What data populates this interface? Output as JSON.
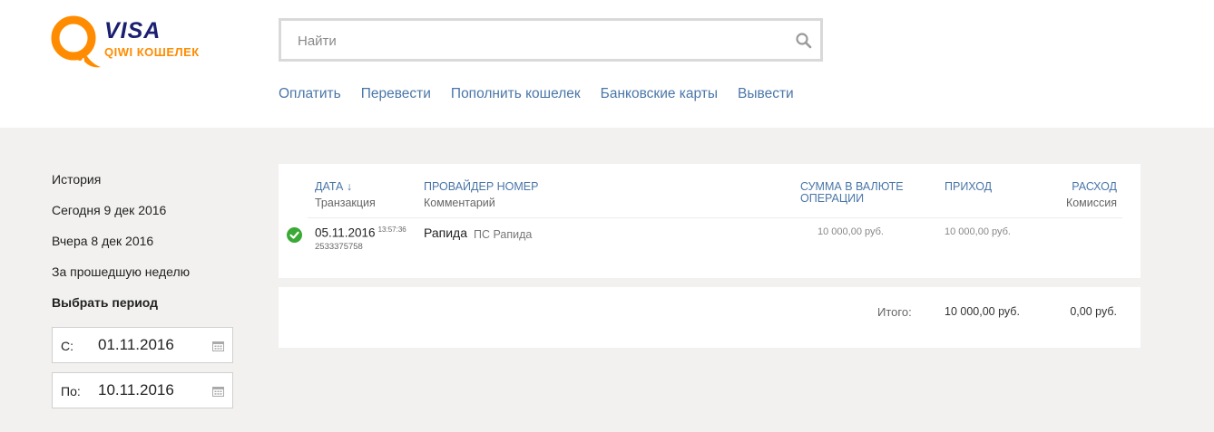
{
  "brand": {
    "visa": "VISA",
    "qiwi": "QIWI КОШЕЛЕК",
    "accent_orange": "#ff8c00",
    "link_blue": "#4a76a8"
  },
  "search": {
    "placeholder": "Найти",
    "icon": "search-icon"
  },
  "nav": {
    "items": [
      "Оплатить",
      "Перевести",
      "Пополнить кошелек",
      "Банковские карты",
      "Вывести"
    ]
  },
  "sidebar": {
    "title": "История",
    "today": "Сегодня 9 дек 2016",
    "yesterday": "Вчера 8 дек 2016",
    "last_week": "За прошедшую неделю",
    "choose_period": "Выбрать период",
    "from_label": "С:",
    "from_value": "01.11.2016",
    "to_label": "По:",
    "to_value": "10.11.2016"
  },
  "table": {
    "headers": {
      "date": "ДАТА ↓",
      "date_sub": "Транзакция",
      "provider": "ПРОВАЙДЕР НОМЕР",
      "provider_sub": "Комментарий",
      "amount": "СУММА В ВАЛЮТЕ",
      "amount_2": "ОПЕРАЦИИ",
      "income": "ПРИХОД",
      "expense": "РАСХОД",
      "expense_sub": "Комиссия"
    },
    "rows": [
      {
        "status": "success",
        "date": "05.11.2016",
        "time": "13:57:36",
        "transaction": "2533375758",
        "provider": "Рапида",
        "comment": "ПС Рапида",
        "amount": "10 000,00 руб.",
        "income": "10 000,00 руб."
      }
    ]
  },
  "totals": {
    "label": "Итого:",
    "income": "10 000,00 руб.",
    "expense": "0,00 руб."
  }
}
